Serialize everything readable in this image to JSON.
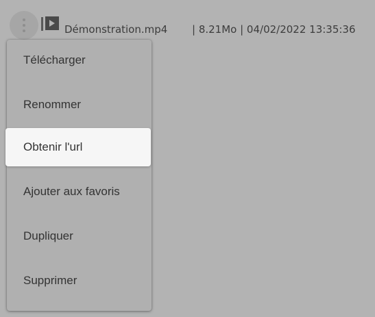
{
  "file": {
    "icon": "video-file-icon",
    "name": "Démonstration.mp4",
    "meta": "| 8.21Mo | 04/02/2022 13:35:36"
  },
  "menu": {
    "items": [
      {
        "label": "Télécharger"
      },
      {
        "label": "Renommer"
      },
      {
        "label": "Obtenir l'url",
        "active": true
      },
      {
        "label": "Ajouter aux favoris"
      },
      {
        "label": "Dupliquer"
      },
      {
        "label": "Supprimer"
      }
    ]
  },
  "colors": {
    "overlay": "#b3b3b3",
    "highlight": "#f6f6f6",
    "text": "#333333"
  }
}
